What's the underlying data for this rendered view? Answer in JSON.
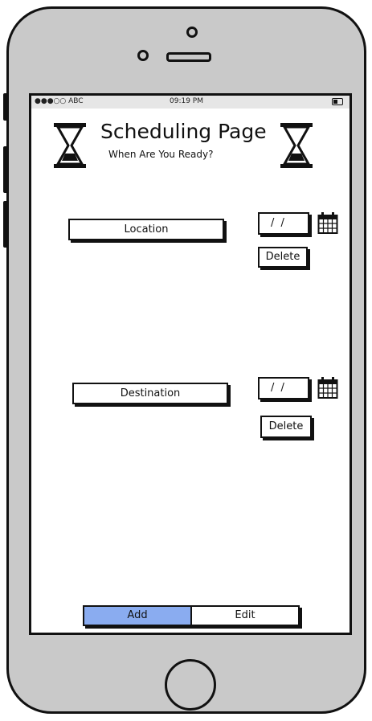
{
  "status_bar": {
    "carrier": "●●●○○ ABC",
    "time": "09:19 PM"
  },
  "header": {
    "title": "Scheduling Page",
    "subtitle": "When Are You Ready?"
  },
  "rows": [
    {
      "label": "Location",
      "date_value": "/ /",
      "delete_label": "Delete"
    },
    {
      "label": "Destination",
      "date_value": "/ /",
      "delete_label": "Delete"
    }
  ],
  "segmented": {
    "options": [
      "Add",
      "Edit"
    ],
    "selected": "Add"
  },
  "colors": {
    "accent": "#8aacf0",
    "phone_body": "#c9c9c9",
    "status_bar": "#e6e6e6"
  }
}
